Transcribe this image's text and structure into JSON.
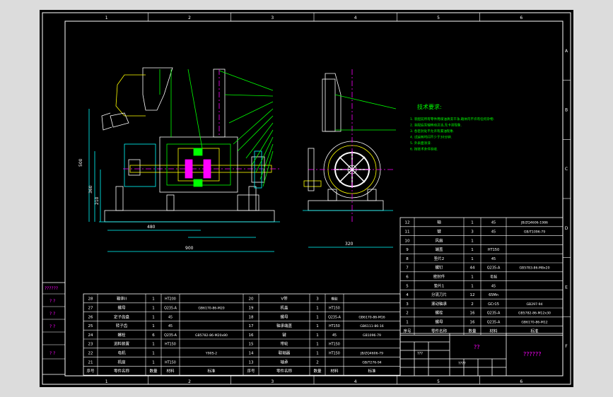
{
  "viewport": {
    "background": "#000000",
    "line_color": "#ffffff",
    "accent_green": "#00ff00",
    "accent_yellow": "#ffff00",
    "accent_cyan": "#00ffff",
    "accent_magenta": "#ff00ff"
  },
  "border_markers": {
    "columns": [
      "1",
      "2",
      "3",
      "4",
      "5",
      "6"
    ],
    "rows": [
      "A",
      "B",
      "C",
      "D",
      "E",
      "F"
    ]
  },
  "tech_requirements": {
    "title": "技术要求:",
    "lines": [
      "1. 装配前所有零件用煤油清洗干净,箱体内不许有任何杂物.",
      "2. 装配后泵轴转动灵活,无卡滞现象.",
      "3. 各密封处不允许有漏油现象.",
      "4. 试运转时间不少于30分钟.",
      "5. 外表面涂漆.",
      "6. 按技术条件验收."
    ]
  },
  "left_side_codes": {
    "top": "??????",
    "mid1": "? ?",
    "mid2": "? ?",
    "mid3": "? ?",
    "mid4": "? ?"
  },
  "bom_right": {
    "rows": [
      {
        "no": "12",
        "name": "轴",
        "qty": "1",
        "material": "45",
        "std": "JB/ZQ4606-1986"
      },
      {
        "no": "11",
        "name": "键",
        "qty": "3",
        "material": "45",
        "std": "GB/T1096-79"
      },
      {
        "no": "10",
        "name": "风扇",
        "qty": "1",
        "material": "",
        "std": ""
      },
      {
        "no": "9",
        "name": "端盖",
        "qty": "1",
        "material": "HT150",
        "std": ""
      },
      {
        "no": "8",
        "name": "垫片2",
        "qty": "1",
        "material": "45",
        "std": ""
      },
      {
        "no": "7",
        "name": "螺钉",
        "qty": "44",
        "material": "Q235-A",
        "std": "GB5783-86-M8x20"
      },
      {
        "no": "6",
        "name": "密封件",
        "qty": "1",
        "material": "毛毡",
        "std": ""
      },
      {
        "no": "5",
        "name": "垫片1",
        "qty": "1",
        "material": "45",
        "std": ""
      },
      {
        "no": "4",
        "name": "分流刀片",
        "qty": "12",
        "material": "65Mn",
        "std": ""
      },
      {
        "no": "3",
        "name": "滚动轴承",
        "qty": "2",
        "material": "GCr15",
        "std": "GB297-94"
      },
      {
        "no": "2",
        "name": "螺栓",
        "qty": "16",
        "material": "Q235-A",
        "std": "GB5782-86-M12x30"
      },
      {
        "no": "1",
        "name": "螺母",
        "qty": "16",
        "material": "Q235-A",
        "std": "GB6170-86-M12"
      }
    ],
    "header": {
      "no": "序号",
      "name": "零件名称",
      "qty": "数量",
      "material": "材料",
      "std": "标准"
    }
  },
  "bom_bottom": {
    "left_rows": [
      {
        "no": "28",
        "name": "箱体II",
        "qty": "1",
        "material": "HT200",
        "std": ""
      },
      {
        "no": "27",
        "name": "螺母",
        "qty": "1",
        "material": "Q235-A",
        "std": "GB6170-86-M20"
      },
      {
        "no": "26",
        "name": "定子齿盘",
        "qty": "1",
        "material": "45",
        "std": ""
      },
      {
        "no": "25",
        "name": "转子齿",
        "qty": "1",
        "material": "45",
        "std": ""
      },
      {
        "no": "24",
        "name": "螺栓",
        "qty": "6",
        "material": "Q235-A",
        "std": "GB5782-86-M20x80"
      },
      {
        "no": "23",
        "name": "进料装置",
        "qty": "1",
        "material": "HT150",
        "std": ""
      },
      {
        "no": "22",
        "name": "电机",
        "qty": "1",
        "material": "",
        "std": "Y90S-2"
      },
      {
        "no": "21",
        "name": "机座",
        "qty": "1",
        "material": "HT150",
        "std": ""
      }
    ],
    "right_rows": [
      {
        "no": "20",
        "name": "V带",
        "qty": "3",
        "material": "橡胶",
        "std": ""
      },
      {
        "no": "19",
        "name": "机盖",
        "qty": "1",
        "material": "HT150",
        "std": ""
      },
      {
        "no": "18",
        "name": "螺母",
        "qty": "1",
        "material": "Q235-A",
        "std": "GB6170-86-M16"
      },
      {
        "no": "17",
        "name": "轴承端盖",
        "qty": "1",
        "material": "HT150",
        "std": "GB6111-86-16"
      },
      {
        "no": "16",
        "name": "键",
        "qty": "1",
        "material": "45",
        "std": "GB1096-79"
      },
      {
        "no": "15",
        "name": "带轮",
        "qty": "1",
        "material": "HT150",
        "std": ""
      },
      {
        "no": "14",
        "name": "联轴器",
        "qty": "1",
        "material": "HT150",
        "std": "JB/ZQ4606-79"
      },
      {
        "no": "13",
        "name": "轴承",
        "qty": "2",
        "material": "",
        "std": "GB/T276-94"
      }
    ],
    "header": {
      "no": "序号",
      "name": "零件名称",
      "qty": "数量",
      "material": "材料",
      "std": "标准"
    }
  },
  "title_block": {
    "drawing_name": "??",
    "company": "??????",
    "scale_cell": "???",
    "sheet_cell": "????"
  },
  "dimensions": {
    "left_height": "500",
    "left_mid": "360",
    "left_low": "210",
    "bottom_total": "900",
    "bottom_mid": "480",
    "right_width": "320"
  }
}
